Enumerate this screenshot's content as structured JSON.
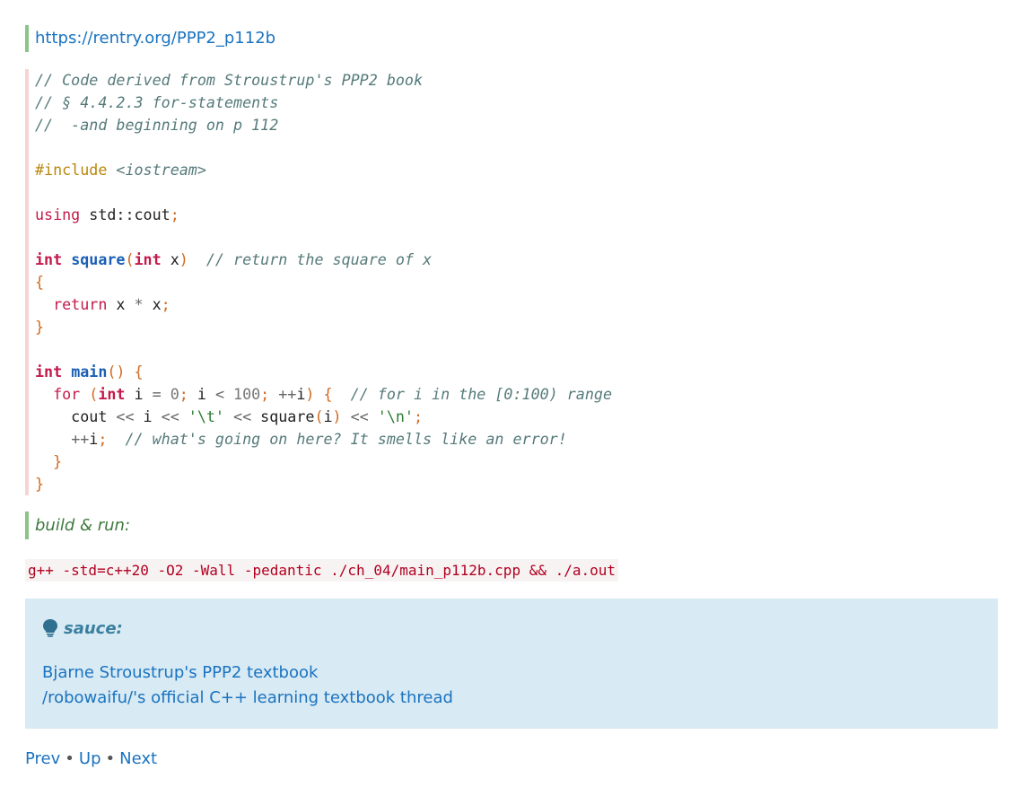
{
  "url_link": "https://rentry.org/PPP2_p112b",
  "code": {
    "line1": "// Code derived from Stroustrup's PPP2 book",
    "line2": "// § 4.4.2.3 for-statements",
    "line3": "//  -and beginning on p 112",
    "include_directive": "#include",
    "include_header": "<iostream>",
    "using_kw": "using",
    "using_target": "std::cout",
    "square_comment": "// return the square of x",
    "for_comment": "// for i in the [0:100) range",
    "loop_comment": "// what's going on here? It smells like an error!"
  },
  "build_label": "build & run:",
  "build_command": "g++ -std=c++20 -O2 -Wall -pedantic ./ch_04/main_p112b.cpp && ./a.out",
  "sauce": {
    "title": "sauce:",
    "links": [
      "Bjarne Stroustrup's PPP2 textbook",
      "/robowaifu/'s official C++ learning textbook thread"
    ]
  },
  "nav": {
    "prev": "Prev",
    "up": "Up",
    "next": "Next",
    "separator": "•"
  },
  "colors": {
    "link": "#1a73c0",
    "quote_border": "#8bc38b",
    "code_border": "#f6d4d4",
    "admonition_bg": "#d8eaf3",
    "keyword": "#c41a4a",
    "comment": "#567a7a"
  }
}
